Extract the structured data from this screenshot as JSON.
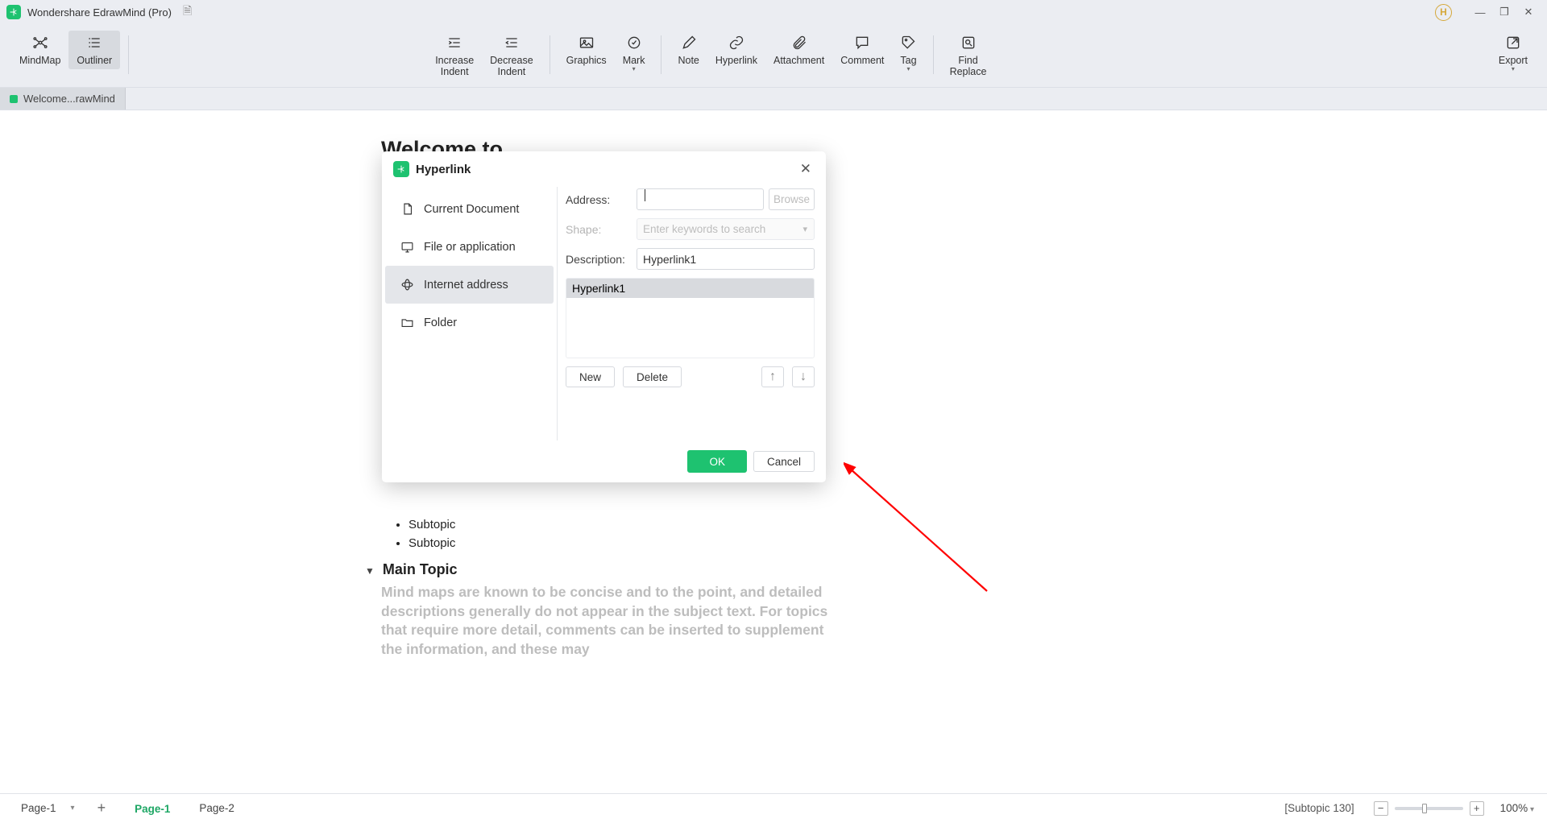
{
  "title": "Wondershare EdrawMind (Pro)",
  "avatar": "H",
  "ribbon": {
    "mindmap": "MindMap",
    "outliner": "Outliner",
    "inc_indent": "Increase\nIndent",
    "dec_indent": "Decrease\nIndent",
    "graphics": "Graphics",
    "mark": "Mark",
    "note": "Note",
    "hyperlink": "Hyperlink",
    "attachment": "Attachment",
    "comment": "Comment",
    "tag": "Tag",
    "find_replace": "Find\nReplace",
    "export": "Export"
  },
  "doctab": "Welcome...rawMind",
  "outline": {
    "h1": "Welcome to",
    "sub1": "Subtopic",
    "sub2": "Subtopic",
    "main": "Main Topic",
    "desc": "Mind maps are known to be concise and to the point, and detailed descriptions generally do not appear in the subject text. For topics that require more detail, comments can be inserted to supplement the information, and these may"
  },
  "dialog": {
    "title": "Hyperlink",
    "opts": {
      "doc": "Current Document",
      "file": "File or application",
      "internet": "Internet address",
      "folder": "Folder"
    },
    "address_lbl": "Address:",
    "browse": "Browse",
    "shape_lbl": "Shape:",
    "shape_ph": "Enter keywords to search",
    "desc_lbl": "Description:",
    "desc_val": "Hyperlink1",
    "list_item": "Hyperlink1",
    "new": "New",
    "delete": "Delete",
    "ok": "OK",
    "cancel": "Cancel"
  },
  "status": {
    "pgsel": "Page-1",
    "p1": "Page-1",
    "p2": "Page-2",
    "subtopic": "[Subtopic 130]",
    "zoom": "100%"
  }
}
